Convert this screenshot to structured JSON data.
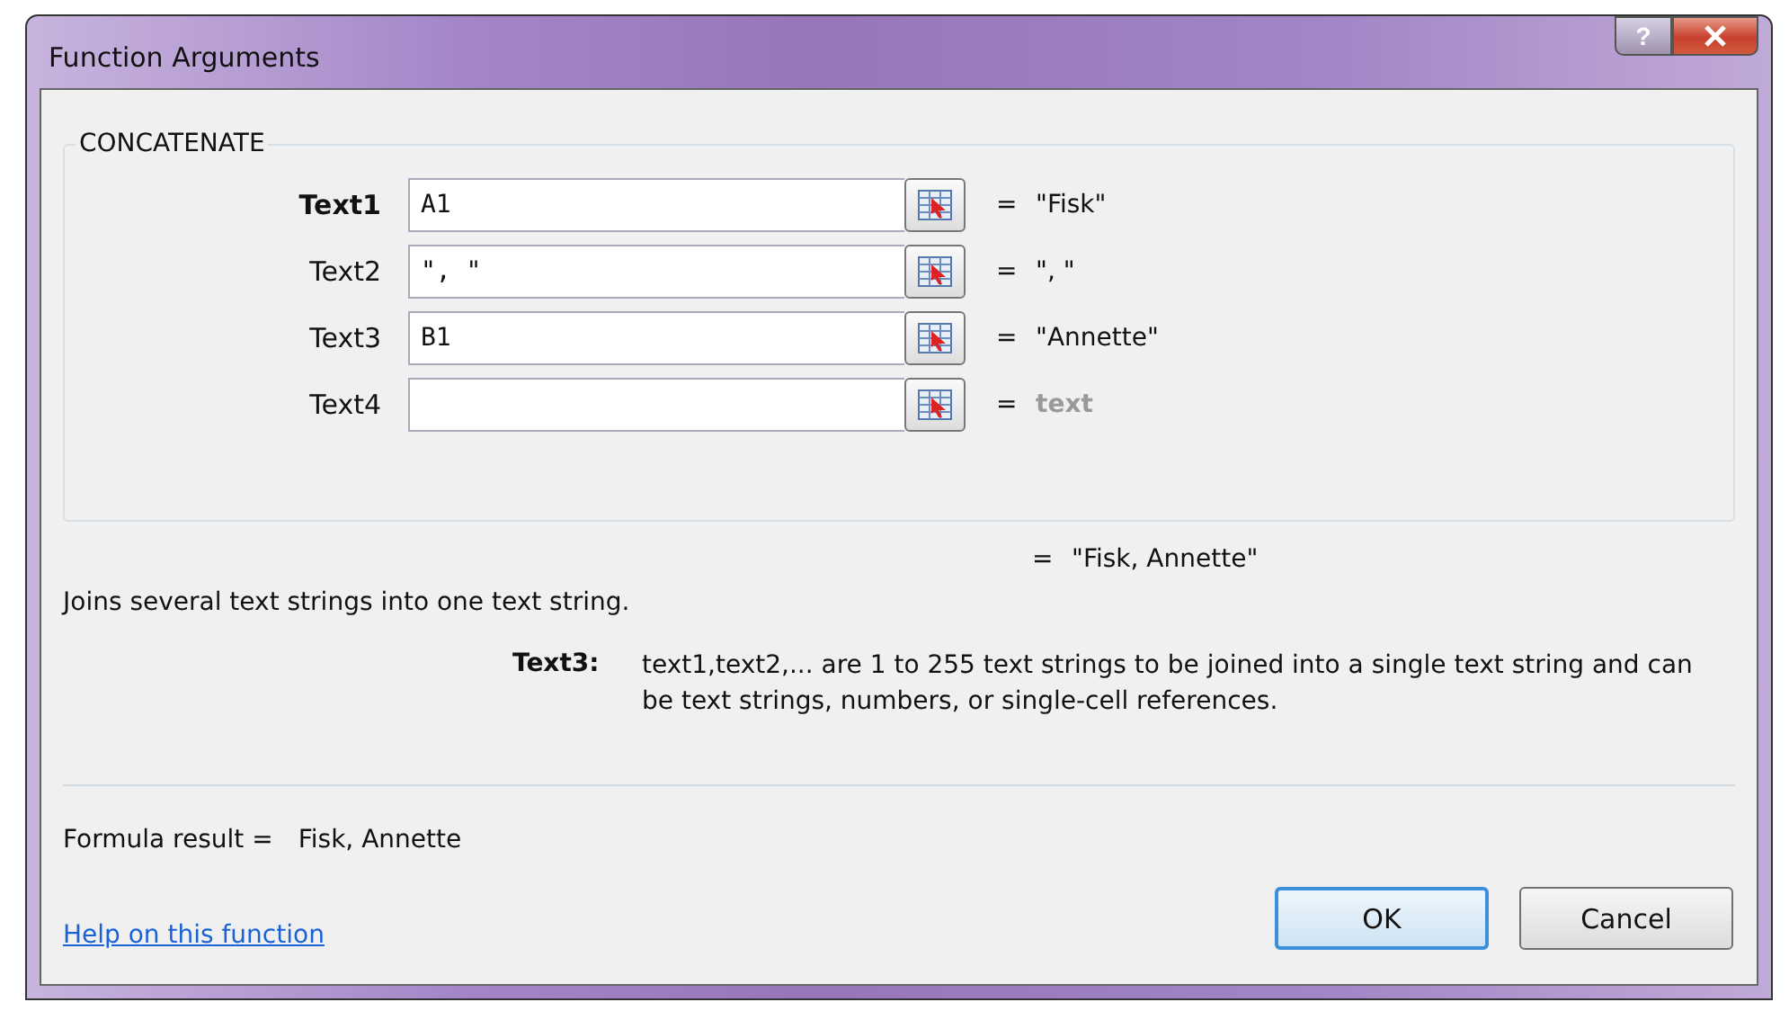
{
  "window": {
    "title": "Function Arguments"
  },
  "function_name": "CONCATENATE",
  "arguments": [
    {
      "label": "Text1",
      "value": "A1",
      "result": "\"Fisk\"",
      "active": true
    },
    {
      "label": "Text2",
      "value": "\", \"",
      "result": "\", \"",
      "active": false
    },
    {
      "label": "Text3",
      "value": "B1",
      "result": "\"Annette\"",
      "active": false
    },
    {
      "label": "Text4",
      "result_hint": "text",
      "active": false
    }
  ],
  "equals": "=",
  "function_result": "\"Fisk, Annette\"",
  "description": "Joins several text strings into one text string.",
  "argument_help": {
    "label": "Text3:",
    "text": "text1,text2,... are 1 to 255 text strings to be joined into a single text string and can be text strings, numbers, or single-cell references."
  },
  "formula_result": {
    "label": "Formula result =",
    "value": "Fisk, Annette"
  },
  "help_link": "Help on this function",
  "buttons": [
    {
      "label": "OK",
      "default": true
    },
    {
      "label": "Cancel",
      "default": false
    }
  ],
  "title_buttons": {
    "help": "?"
  }
}
